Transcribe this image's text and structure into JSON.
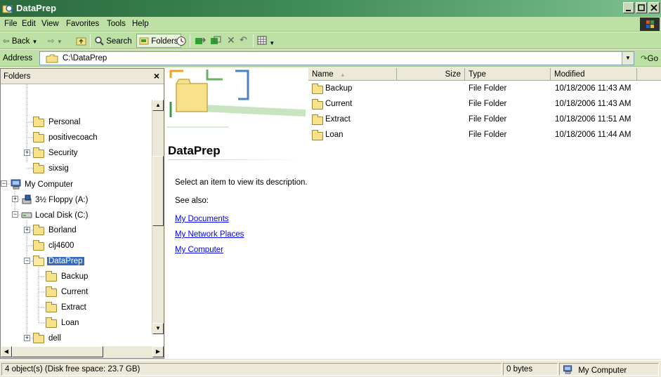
{
  "window": {
    "title": "DataPrep",
    "controls": [
      "minimize",
      "maximize",
      "close"
    ]
  },
  "menubar": {
    "items": [
      {
        "label": "File"
      },
      {
        "label": "Edit"
      },
      {
        "label": "View"
      },
      {
        "label": "Favorites"
      },
      {
        "label": "Tools"
      },
      {
        "label": "Help"
      }
    ]
  },
  "toolbar": {
    "back_label": "Back",
    "search_label": "Search",
    "folders_label": "Folders"
  },
  "address": {
    "label": "Address",
    "value": "C:\\DataPrep",
    "go_label": "Go"
  },
  "folders_pane": {
    "title": "Folders",
    "close_glyph": "×",
    "tree": [
      {
        "label": "Personal",
        "icon": "folder-icon",
        "expander": ""
      },
      {
        "label": "positivecoach",
        "icon": "folder-icon",
        "expander": ""
      },
      {
        "label": "Security",
        "icon": "folder-icon",
        "expander": "+"
      },
      {
        "label": "sixsig",
        "icon": "folder-icon",
        "expander": ""
      },
      {
        "label": "My Computer",
        "icon": "computer-icon",
        "expander": "-"
      },
      {
        "label": "3½ Floppy (A:)",
        "icon": "floppy-icon",
        "expander": "+"
      },
      {
        "label": "Local Disk (C:)",
        "icon": "drive-icon",
        "expander": "-"
      },
      {
        "label": "Borland",
        "icon": "folder-icon",
        "expander": "+"
      },
      {
        "label": "clj4600",
        "icon": "folder-icon",
        "expander": ""
      },
      {
        "label": "DataPrep",
        "icon": "folder-open-icon",
        "expander": "-",
        "selected": true
      },
      {
        "label": "Backup",
        "icon": "folder-icon",
        "expander": ""
      },
      {
        "label": "Current",
        "icon": "folder-icon",
        "expander": ""
      },
      {
        "label": "Extract",
        "icon": "folder-icon",
        "expander": ""
      },
      {
        "label": "Loan",
        "icon": "folder-icon",
        "expander": ""
      },
      {
        "label": "dell",
        "icon": "folder-icon",
        "expander": "+"
      }
    ]
  },
  "webview": {
    "title": "DataPrep",
    "description": "Select an item to view its description.",
    "see_also": "See also:",
    "links": [
      "My Documents",
      "My Network Places",
      "My Computer"
    ]
  },
  "listview": {
    "columns": [
      "Name",
      "Size",
      "Type",
      "Modified"
    ],
    "sort_indicator": "▲",
    "rows": [
      {
        "name": "Backup",
        "size": "",
        "type": "File Folder",
        "modified": "10/18/2006 11:43 AM"
      },
      {
        "name": "Current",
        "size": "",
        "type": "File Folder",
        "modified": "10/18/2006 11:43 AM"
      },
      {
        "name": "Extract",
        "size": "",
        "type": "File Folder",
        "modified": "10/18/2006 11:51 AM"
      },
      {
        "name": "Loan",
        "size": "",
        "type": "File Folder",
        "modified": "10/18/2006 11:44 AM"
      }
    ]
  },
  "statusbar": {
    "objects": "4 object(s) (Disk free space: 23.7 GB)",
    "size": "0 bytes",
    "zone": "My Computer"
  },
  "colors": {
    "titlebar": "#3f8a55",
    "chrome": "#bde0a4",
    "selection": "#316ac5",
    "link": "#0000ff"
  }
}
